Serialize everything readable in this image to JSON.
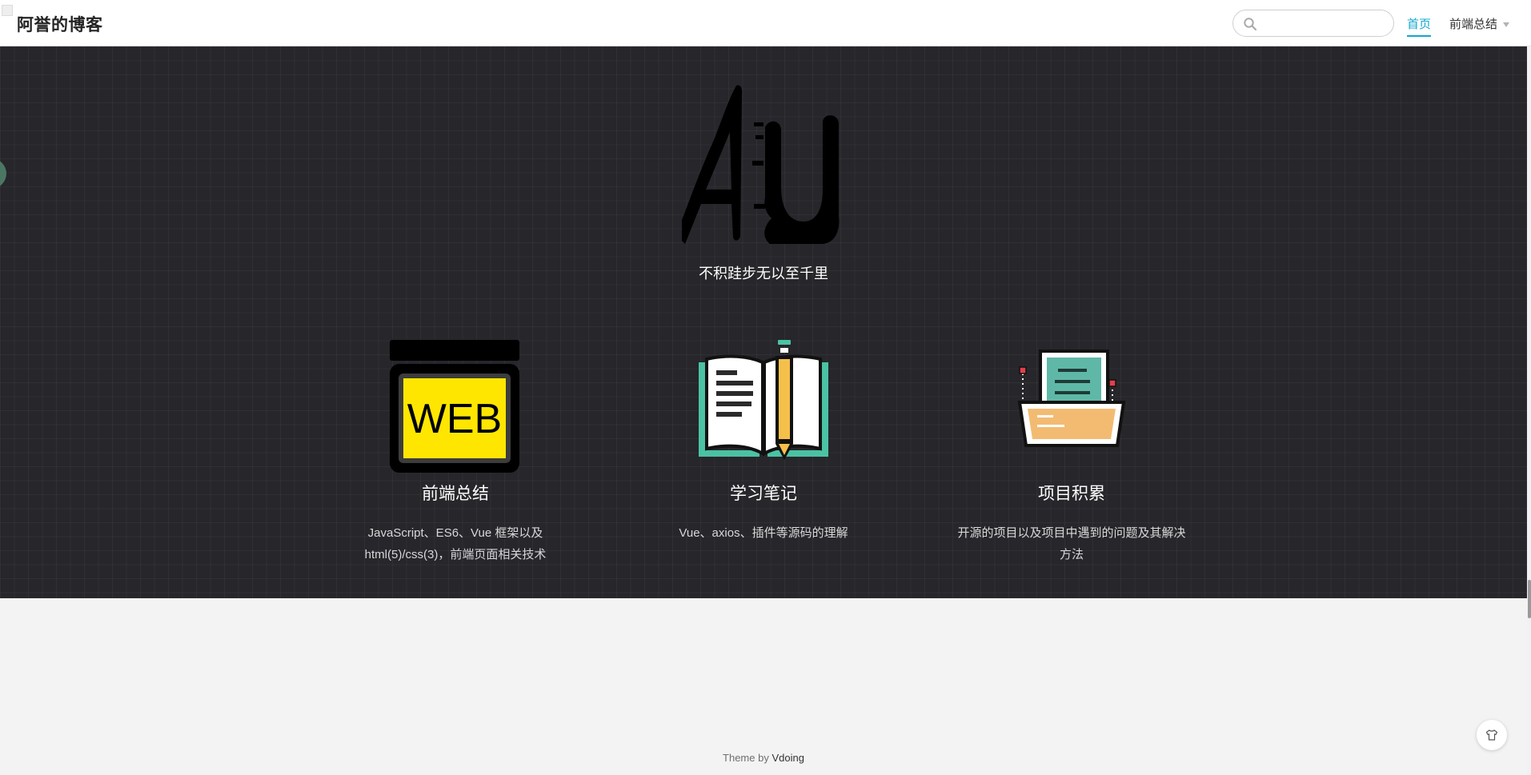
{
  "header": {
    "site_title": "阿誉的博客",
    "search": {
      "value": "",
      "placeholder": ""
    },
    "nav": {
      "home": "首页",
      "frontend": "前端总结"
    }
  },
  "hero": {
    "logo_text": "AU",
    "tagline": "不积跬步无以至千里",
    "features": [
      {
        "title": "前端总结",
        "desc_line1": "JavaScript、ES6、Vue 框架以及",
        "desc_line2": "html(5)/css(3)，前端页面相关技术",
        "icon_text": "WEB",
        "icon": "web-icon"
      },
      {
        "title": "学习笔记",
        "desc_line1": "Vue、axios、插件等源码的理解",
        "desc_line2": "",
        "icon": "open-book-icon"
      },
      {
        "title": "项目积累",
        "desc_line1": "开源的项目以及项目中遇到的问题及其解决",
        "desc_line2": "方法",
        "icon": "folder-document-icon"
      }
    ]
  },
  "footer": {
    "prefix": "Theme by",
    "brand": "Vdoing"
  },
  "colors": {
    "hero_bg": "#26262b",
    "accent": "#11a8cd",
    "web_yellow": "#ffe600",
    "book_green": "#4bc2a3",
    "pencil_yellow": "#f5c04a",
    "folder_teal": "#5fb8a7",
    "folder_orange": "#f3bb72"
  }
}
